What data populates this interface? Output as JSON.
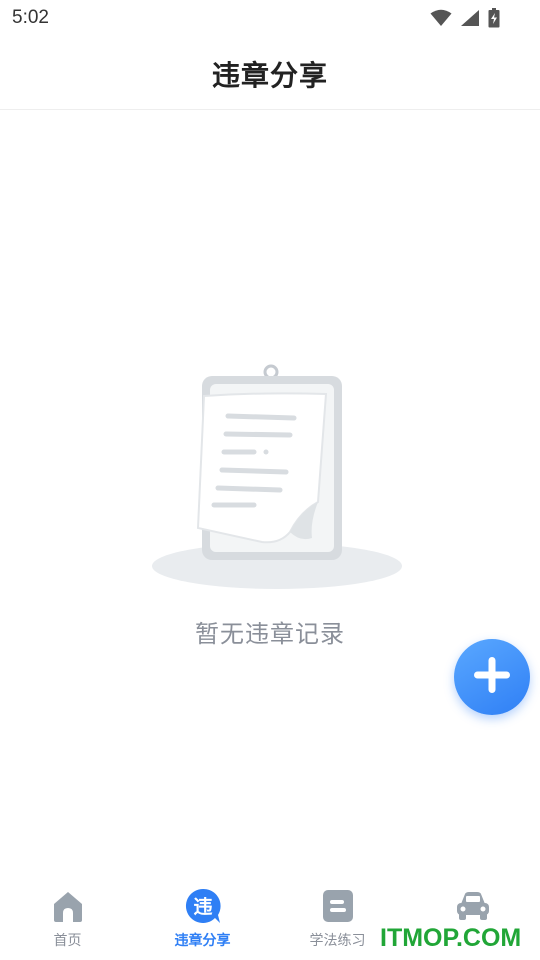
{
  "status_bar": {
    "time": "5:02"
  },
  "header": {
    "title": "违章分享"
  },
  "empty_state": {
    "message": "暂无违章记录"
  },
  "nav": {
    "items": [
      {
        "label": "首页",
        "icon": "home-icon"
      },
      {
        "label": "违章分享",
        "icon": "violation-share-icon",
        "icon_text": "违",
        "active": true
      },
      {
        "label": "学法练习",
        "icon": "document-icon"
      },
      {
        "label": "",
        "icon": "car-icon"
      }
    ]
  },
  "fab": {
    "icon": "plus-icon"
  },
  "watermark": {
    "text": "ITMOP.COM"
  },
  "colors": {
    "accent": "#2f7ff5",
    "inactive": "#8a8f99",
    "watermark": "#21a637"
  }
}
